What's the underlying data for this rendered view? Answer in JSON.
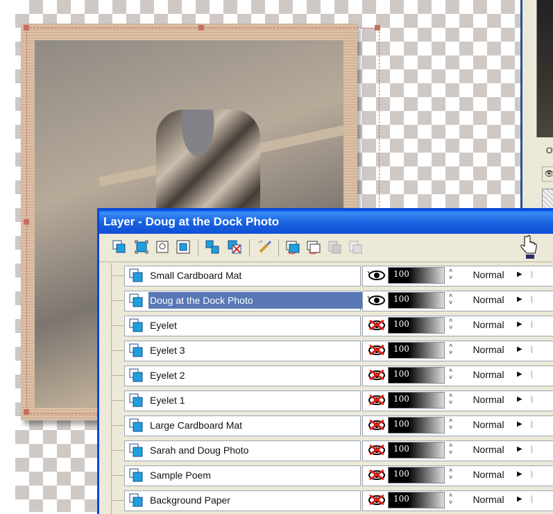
{
  "window": {
    "title": "Layer - Doug at the Dock Photo"
  },
  "side_panel": {
    "label": "Ov"
  },
  "toolbar": {
    "buttons": [
      {
        "name": "new-layer-icon"
      },
      {
        "name": "layer-properties-icon"
      },
      {
        "name": "mask-icon"
      },
      {
        "name": "merge-icon"
      },
      {
        "name": "duplicate-layer-icon"
      },
      {
        "name": "delete-layer-icon"
      },
      {
        "name": "brush-icon"
      },
      {
        "name": "vector-layer-icon"
      },
      {
        "name": "adjust-layer-icon"
      },
      {
        "name": "disabled-layer-icon-1"
      },
      {
        "name": "disabled-layer-icon-2"
      }
    ]
  },
  "layers": [
    {
      "name": "Small Cardboard Mat",
      "visible": true,
      "opacity": "100",
      "blend": "Normal",
      "selected": false
    },
    {
      "name": "Doug at the Dock Photo",
      "visible": true,
      "opacity": "100",
      "blend": "Normal",
      "selected": true
    },
    {
      "name": "Eyelet",
      "visible": false,
      "opacity": "100",
      "blend": "Normal",
      "selected": false
    },
    {
      "name": "Eyelet 3",
      "visible": false,
      "opacity": "100",
      "blend": "Normal",
      "selected": false
    },
    {
      "name": "Eyelet 2",
      "visible": false,
      "opacity": "100",
      "blend": "Normal",
      "selected": false
    },
    {
      "name": "Eyelet 1",
      "visible": false,
      "opacity": "100",
      "blend": "Normal",
      "selected": false
    },
    {
      "name": "Large Cardboard Mat",
      "visible": false,
      "opacity": "100",
      "blend": "Normal",
      "selected": false
    },
    {
      "name": "Sarah and Doug Photo",
      "visible": false,
      "opacity": "100",
      "blend": "Normal",
      "selected": false
    },
    {
      "name": "Sample Poem",
      "visible": false,
      "opacity": "100",
      "blend": "Normal",
      "selected": false
    },
    {
      "name": "Background Paper",
      "visible": false,
      "opacity": "100",
      "blend": "Normal",
      "selected": false
    }
  ],
  "colors": {
    "titlebar": "#1b64df",
    "selection": "#5877b4",
    "mat": "#d8b99d"
  }
}
